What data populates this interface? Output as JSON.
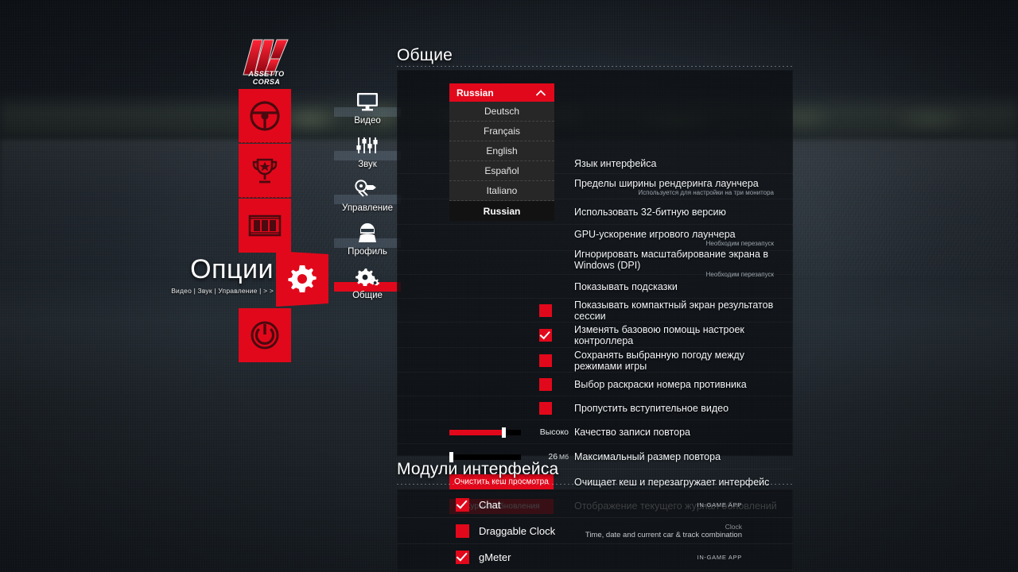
{
  "brand": {
    "logo_name": "ASSETTO CORSA"
  },
  "main_nav": [
    {
      "name": "drive",
      "icon": "steering-wheel-icon",
      "active": false
    },
    {
      "name": "career",
      "icon": "trophy-icon",
      "active": false
    },
    {
      "name": "replay",
      "icon": "film-strip-icon",
      "active": false
    },
    {
      "name": "options",
      "icon": "gear-icon",
      "active": true
    },
    {
      "name": "quit",
      "icon": "power-icon",
      "active": false
    }
  ],
  "page": {
    "title": "Опции",
    "breadcrumb": "Видео | Звук | Управление | > >"
  },
  "subnav": [
    {
      "label": "Видео",
      "icon": "monitor-icon",
      "active": false
    },
    {
      "label": "Звук",
      "icon": "sliders-icon",
      "active": false
    },
    {
      "label": "Управление",
      "icon": "controls-icon",
      "active": false
    },
    {
      "label": "Профиль",
      "icon": "driver-helmet-icon",
      "active": false
    },
    {
      "label": "Общие",
      "icon": "gears-icon",
      "active": true
    }
  ],
  "general": {
    "heading": "Общие",
    "language_dropdown": {
      "selected": "Russian",
      "expanded": true,
      "caret": "chevron-up-icon",
      "options": [
        "Deutsch",
        "Français",
        "English",
        "Español",
        "Italiano",
        "Russian"
      ]
    },
    "rows": [
      {
        "type": "dropdown-anchor",
        "label": "Язык интерфейса",
        "sub": ""
      },
      {
        "type": "blank",
        "label": "Пределы ширины рендеринга лаунчера",
        "sub": "Используется для настройки на три монитора"
      },
      {
        "type": "blank",
        "label": "Использовать 32-битную версию",
        "sub": ""
      },
      {
        "type": "blank",
        "label": "GPU-ускорение игрового лаунчера",
        "sub": "Необходим перезапуск"
      },
      {
        "type": "blank",
        "label": "Игнорировать масштабирование экрана в Windows (DPI)",
        "sub": "Необходим перезапуск"
      },
      {
        "type": "blank",
        "label": "Показывать подсказки",
        "sub": ""
      },
      {
        "type": "checkbox",
        "checked": false,
        "label": "Показывать компактный экран результатов сессии",
        "sub": ""
      },
      {
        "type": "checkbox",
        "checked": true,
        "label": "Изменять базовою помощь настроек контроллера",
        "sub": ""
      },
      {
        "type": "checkbox",
        "checked": false,
        "label": "Сохранять выбранную погоду между режимами игры",
        "sub": ""
      },
      {
        "type": "checkbox",
        "checked": false,
        "label": "Выбор раскраски номера противника",
        "sub": ""
      },
      {
        "type": "checkbox",
        "checked": false,
        "label": "Пропустить вступительное видео",
        "sub": ""
      },
      {
        "type": "slider",
        "percent": 75,
        "value": "Высоко",
        "unit": "",
        "label": "Качество записи повтора",
        "sub": ""
      },
      {
        "type": "slider",
        "percent": 2,
        "value": "26",
        "unit": "Мб",
        "label": "Максимальный размер повтора",
        "sub": ""
      },
      {
        "type": "button",
        "button_label": "Очистить кеш просмотра",
        "label": "Очищает кеш и перезагружает интерфейс",
        "sub": ""
      },
      {
        "type": "button",
        "button_label": "Журнал обновления",
        "label": "Отображение текущего журнал обновлений",
        "sub": ""
      }
    ]
  },
  "modules": {
    "heading": "Модули интерфейса",
    "items": [
      {
        "checked": true,
        "name": "Chat",
        "tag": "IN-GAME APP",
        "title": "",
        "desc": ""
      },
      {
        "checked": false,
        "name": "Draggable Clock",
        "tag": "",
        "title": "Clock",
        "desc": "Time, date and current car & track combination"
      },
      {
        "checked": true,
        "name": "gMeter",
        "tag": "IN-GAME APP",
        "title": "",
        "desc": ""
      }
    ]
  },
  "colors": {
    "accent_red": "#e2081b",
    "panel_bg": "#0c0f13",
    "text": "#f2f4f6",
    "muted": "#9aa3ac"
  }
}
